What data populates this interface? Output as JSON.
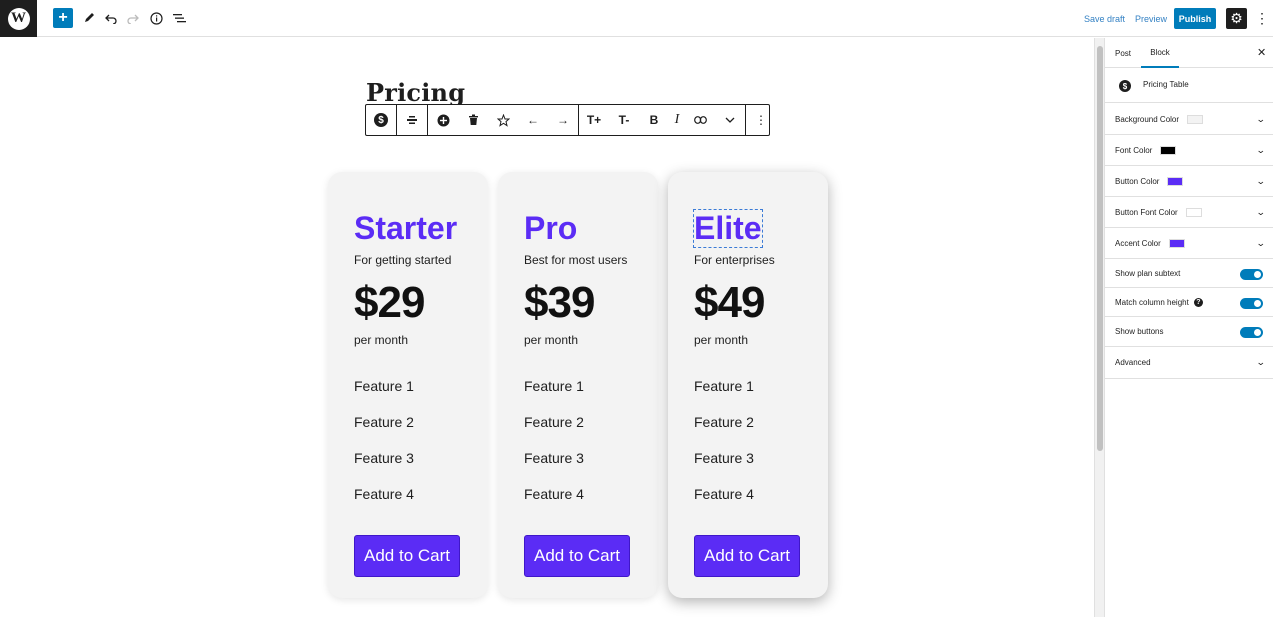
{
  "topbar": {
    "logo": "W",
    "add_icon": "+",
    "tools_icon": "pencil-icon",
    "undo_icon": "undo-icon",
    "redo_icon": "redo-icon",
    "details_icon": "info-icon",
    "outline_icon": "list-view-icon",
    "save_draft": "Save draft",
    "preview": "Preview",
    "publish": "Publish",
    "settings_icon": "gear-icon",
    "more_icon": "⋮"
  },
  "page": {
    "title": "Pricing"
  },
  "block_toolbar": {
    "icons": {
      "block_type": "$",
      "align": "align-icon",
      "add": "plus-circle-icon",
      "delete": "trash-icon",
      "favorite": "star-icon",
      "move_left": "←",
      "move_right": "→",
      "text_bigger": "T+",
      "text_smaller": "T-",
      "bold": "B",
      "italic": "I",
      "link": "link-icon",
      "more_formatting": "chevron-down-icon",
      "options": "⋮"
    }
  },
  "pricing": {
    "accent_color": "#5b2cf5",
    "card_bg": "#f3f3f3",
    "plans": [
      {
        "name": "Starter",
        "subtitle": "For getting started",
        "price": "$29",
        "period": "per month",
        "features": [
          "Feature 1",
          "Feature 2",
          "Feature 3",
          "Feature 4"
        ],
        "button": "Add to Cart"
      },
      {
        "name": "Pro",
        "subtitle": "Best for most users",
        "price": "$39",
        "period": "per month",
        "features": [
          "Feature 1",
          "Feature 2",
          "Feature 3",
          "Feature 4"
        ],
        "button": "Add to Cart"
      },
      {
        "name": "Elite",
        "subtitle": "For enterprises",
        "price": "$49",
        "period": "per month",
        "features": [
          "Feature 1",
          "Feature 2",
          "Feature 3",
          "Feature 4"
        ],
        "button": "Add to Cart"
      }
    ]
  },
  "sidebar": {
    "tabs": [
      "Post",
      "Block"
    ],
    "active_tab": "Block",
    "close_icon": "✕",
    "block_name": "Pricing Table",
    "color_settings": [
      {
        "label": "Background Color",
        "color": "#f3f3f3"
      },
      {
        "label": "Font Color",
        "color": "#000000"
      },
      {
        "label": "Button Color",
        "color": "#5b2cf5"
      },
      {
        "label": "Button Font Color",
        "color": "#ffffff"
      },
      {
        "label": "Accent Color",
        "color": "#5b2cf5"
      }
    ],
    "toggles": [
      {
        "label": "Show plan subtext",
        "on": true
      },
      {
        "label": "Match column height",
        "on": true,
        "help": "?"
      },
      {
        "label": "Show buttons",
        "on": true
      }
    ],
    "advanced": "Advanced"
  }
}
